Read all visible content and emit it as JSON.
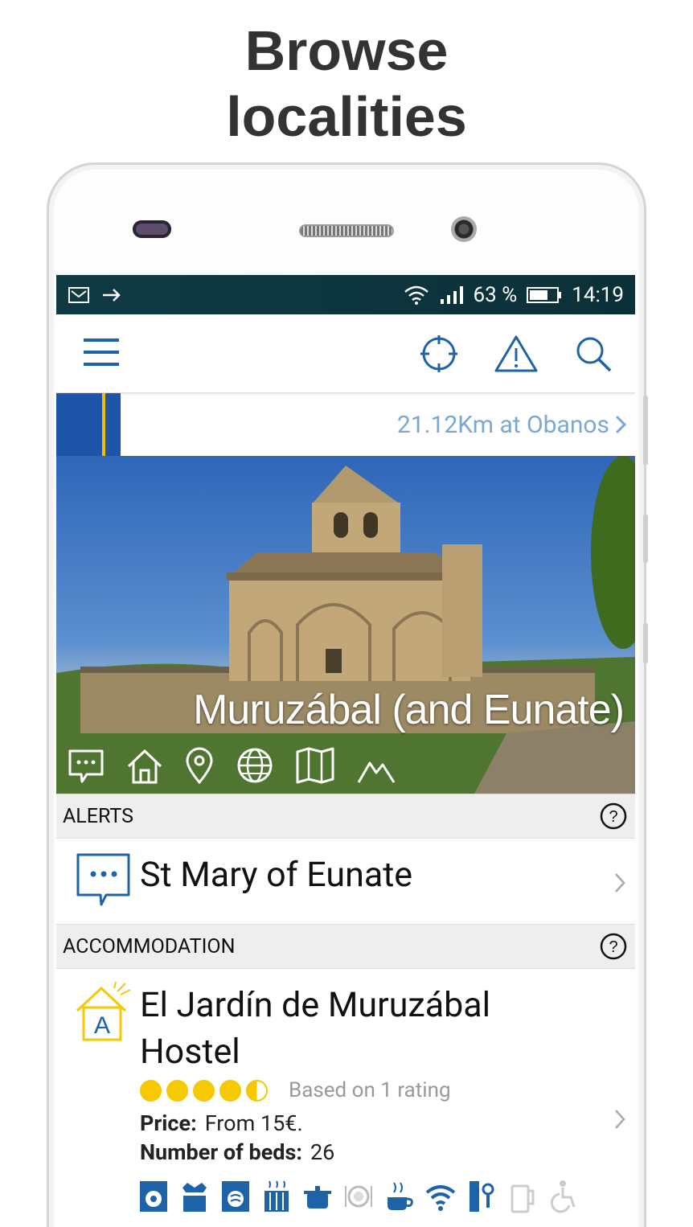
{
  "headline": "Browse\nlocalities",
  "status_bar": {
    "battery": "63 %",
    "time": "14:19"
  },
  "location_bar": {
    "text": "21.12Km at Obanos"
  },
  "hero": {
    "title": "Muruzábal (and Eunate)"
  },
  "sections": {
    "alerts": {
      "label": "ALERTS",
      "item_title": "St Mary of Eunate"
    },
    "accommodation": {
      "label": "ACCOMMODATION",
      "item_title": "El Jardín de Muruzábal Hostel",
      "rating_value": 4.5,
      "rating_text": "Based on 1 rating",
      "price_label": "Price:",
      "price_value": "From 15€.",
      "beds_label": "Number of beds:",
      "beds_value": "26",
      "badge_letter": "A"
    }
  },
  "colors": {
    "accent": "#1e55a8",
    "status_bar": "#0f3a44",
    "star": "#f5c800",
    "link": "#7aa7d6"
  },
  "icons": [
    "menu-icon",
    "locate-icon",
    "warning-icon",
    "search-icon",
    "chat-icon",
    "home-icon",
    "pin-icon",
    "globe-icon",
    "map-icon",
    "mountain-icon"
  ]
}
